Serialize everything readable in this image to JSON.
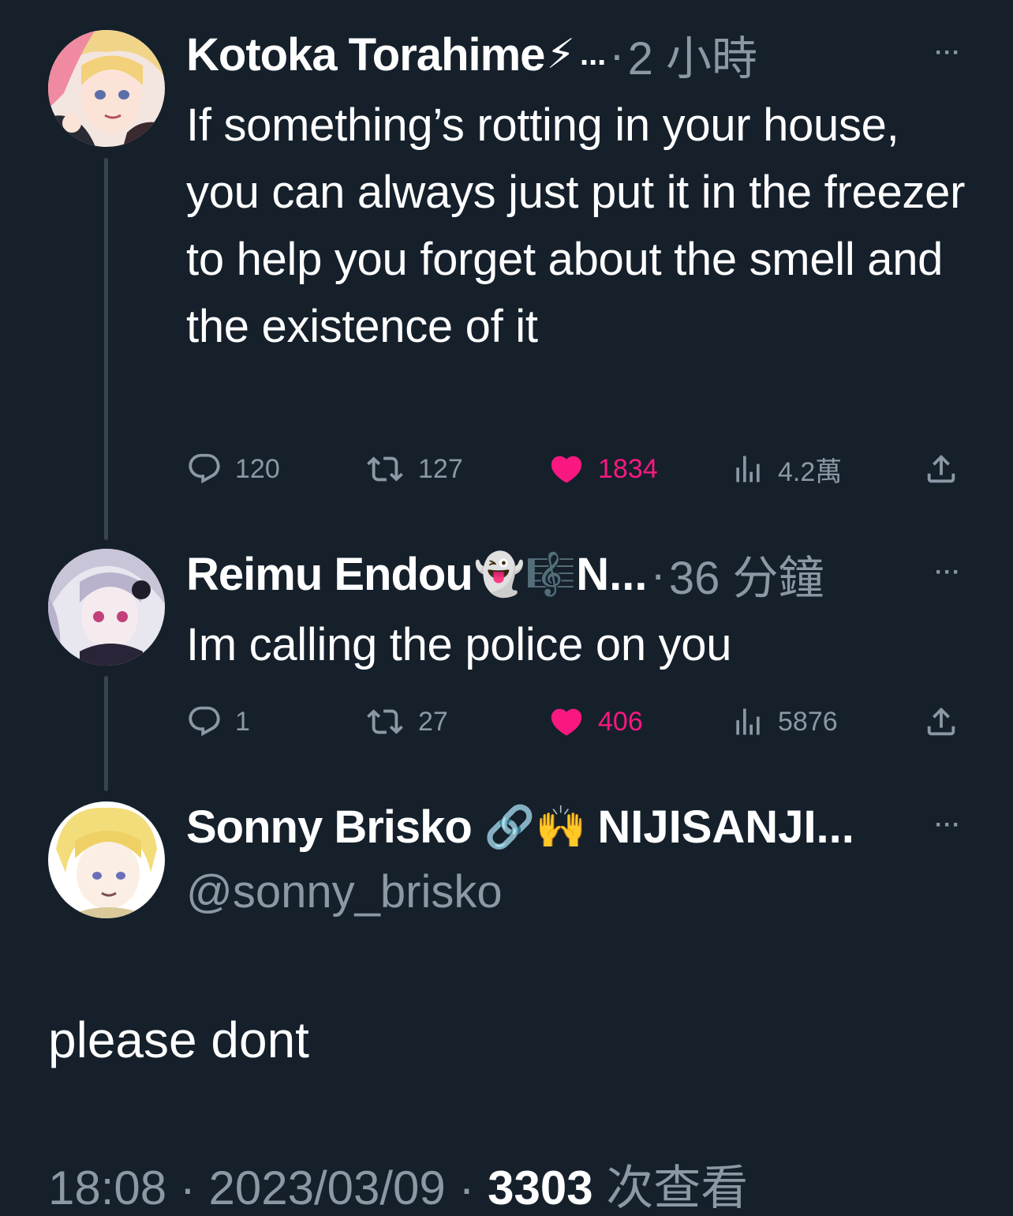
{
  "tweets": [
    {
      "author": "Kotoka Torahime",
      "author_emoji": "⚡",
      "truncation": "...",
      "separator": "·",
      "time": "2 小時",
      "more": "···",
      "text": "If something’s rotting in your house, you can always just put it in the freezer to help you forget about the smell and the existence of it",
      "replies": "120",
      "retweets": "127",
      "likes": "1834",
      "views": "4.2萬"
    },
    {
      "author": "Reimu Endou",
      "author_emoji": "👻🎼",
      "truncation": "N...",
      "separator": "·",
      "time": "36 分鐘",
      "more": "···",
      "text": "Im calling the police on you",
      "replies": "1",
      "retweets": "27",
      "likes": "406",
      "views": "5876"
    }
  ],
  "main_tweet": {
    "author": "Sonny Brisko",
    "author_emoji": "🔗🙌",
    "truncation": "NIJISANJI...",
    "handle": "@sonny_brisko",
    "more": "···",
    "text": "please dont",
    "time": "18:08",
    "separator": "·",
    "date": "2023/03/09",
    "views_count": "3303",
    "views_label": "次查看"
  },
  "colors": {
    "background": "#15202b",
    "muted": "#8b98a5",
    "like": "#f91880",
    "thread_line": "#38444d"
  },
  "icons": [
    "reply-icon",
    "retweet-icon",
    "heart-icon",
    "views-icon",
    "share-icon",
    "more-icon"
  ]
}
